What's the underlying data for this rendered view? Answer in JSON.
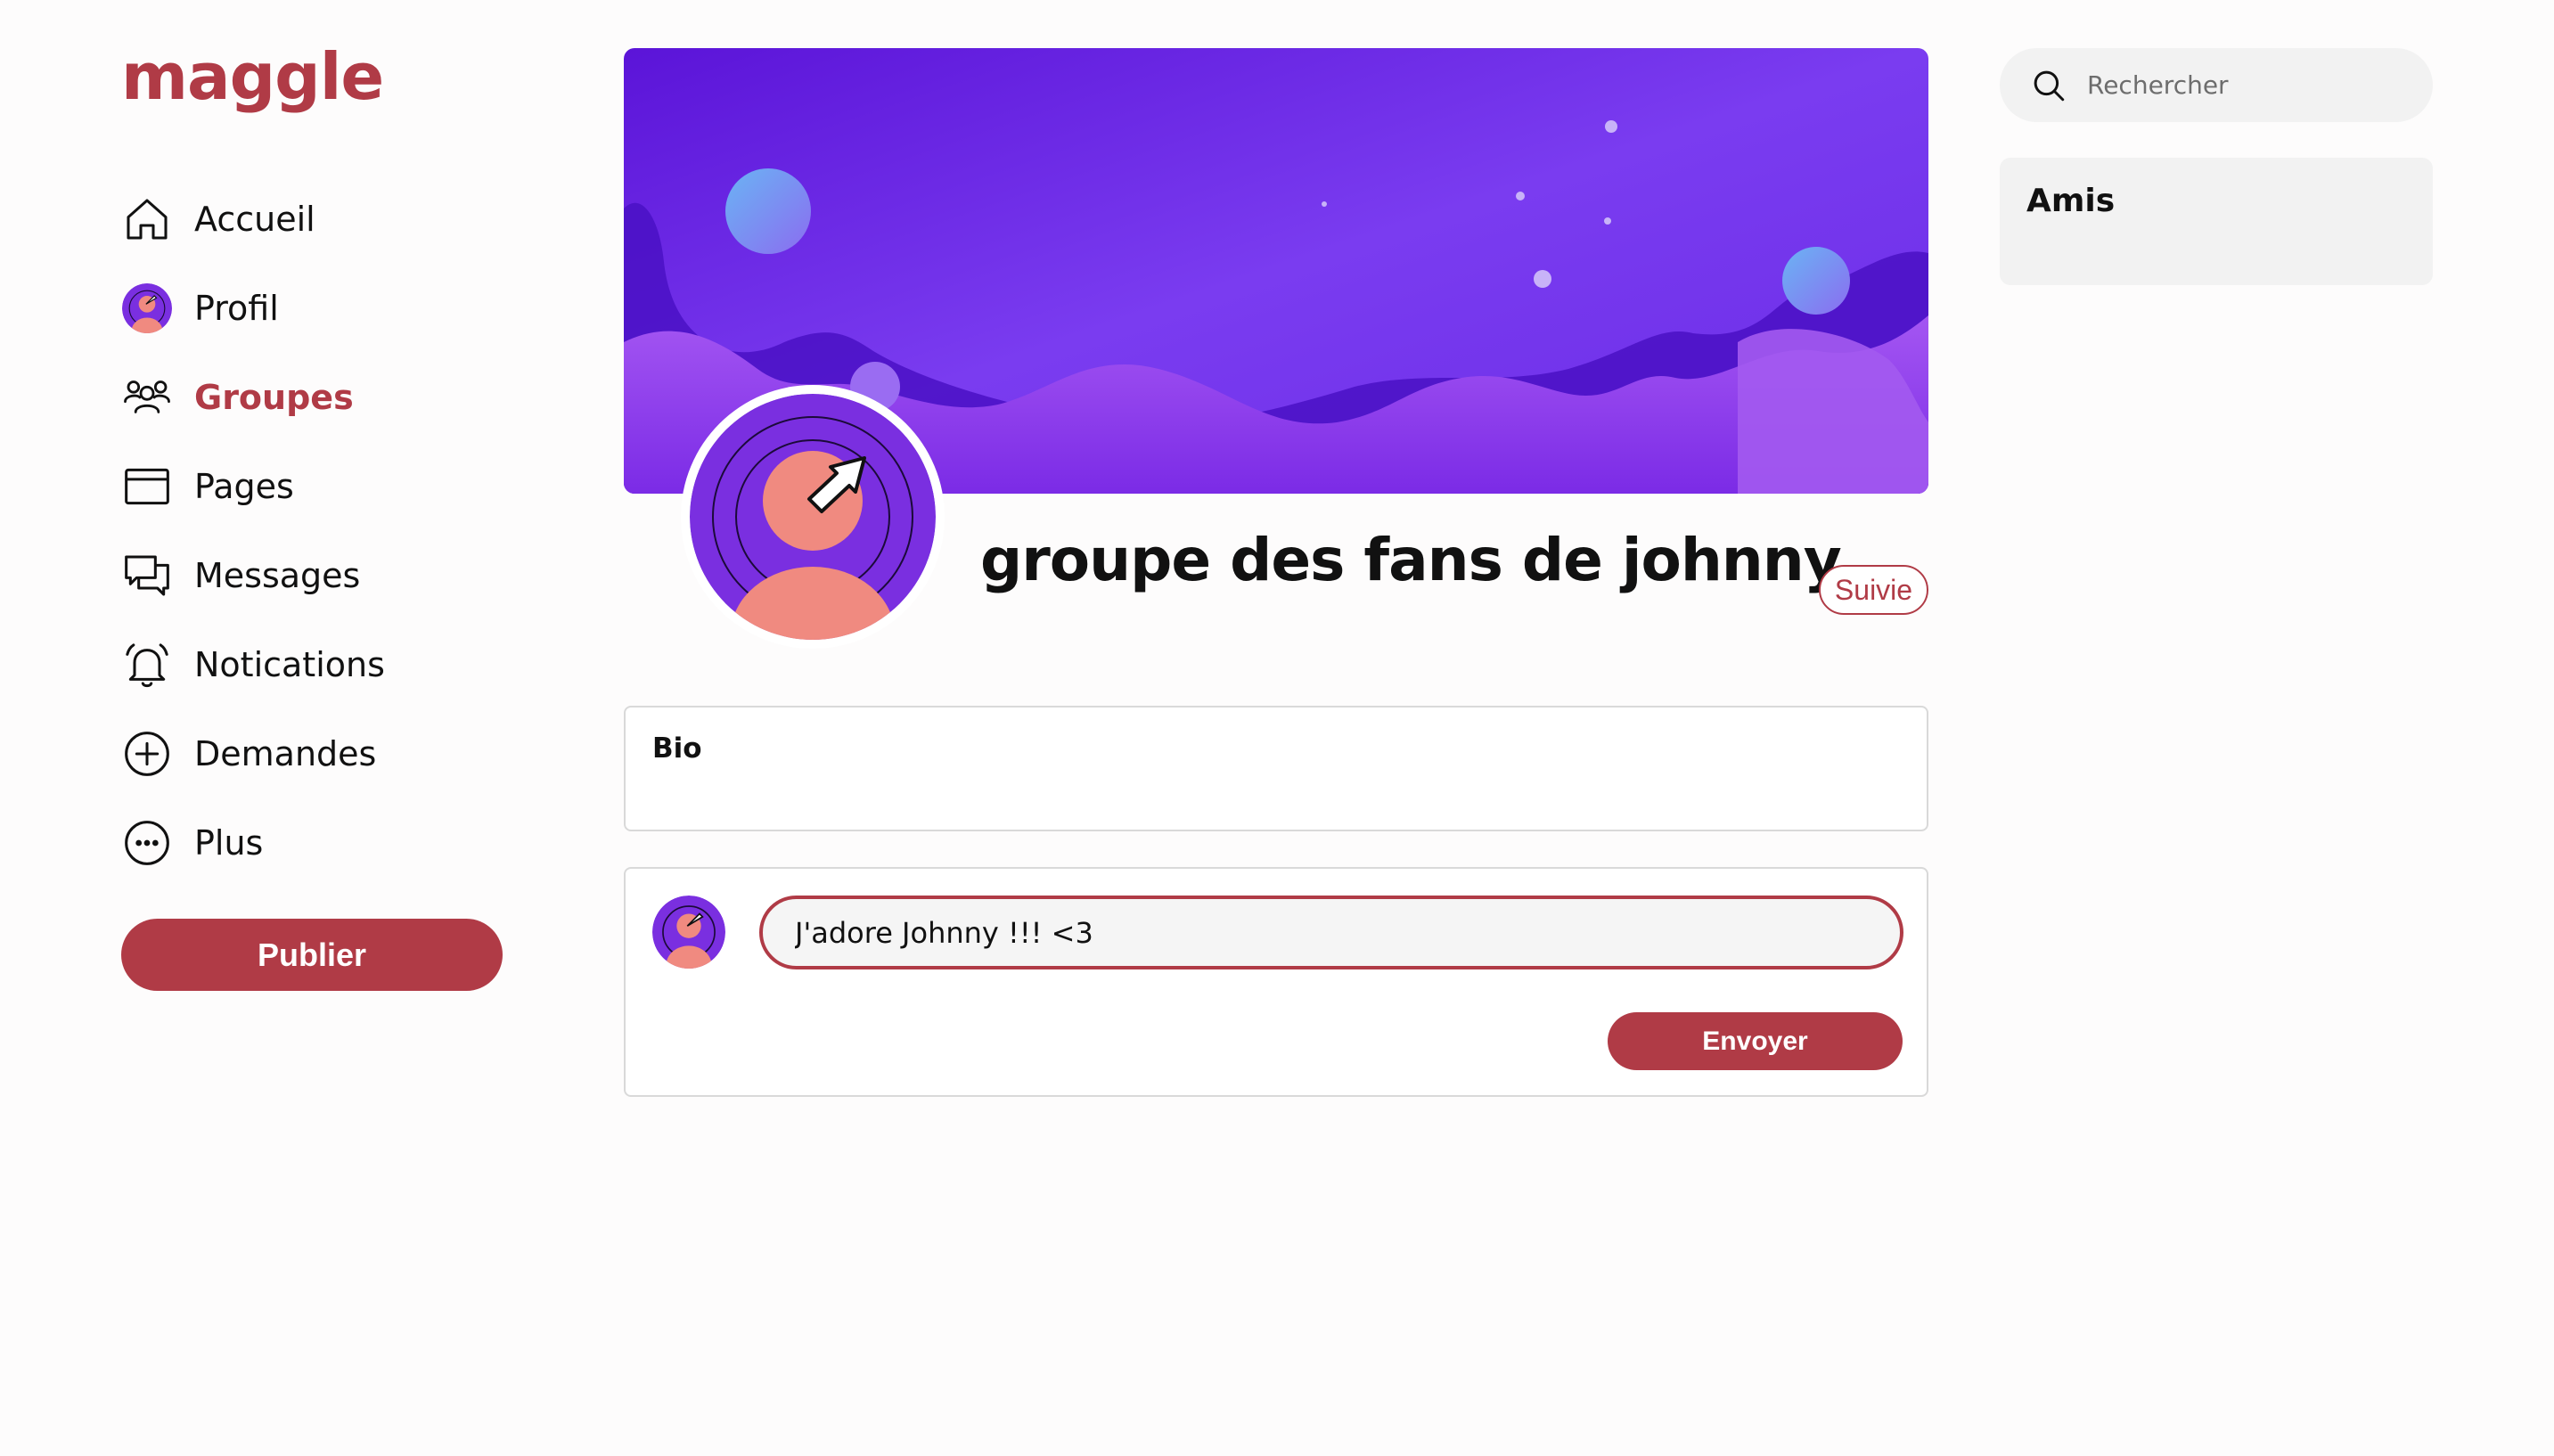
{
  "app": {
    "logo": "maggle",
    "brand_color": "#b03b46"
  },
  "sidebar": {
    "items": [
      {
        "label": "Accueil",
        "icon": "home-icon",
        "active": false
      },
      {
        "label": "Profil",
        "icon": "avatar",
        "active": false
      },
      {
        "label": "Groupes",
        "icon": "users-icon",
        "active": true
      },
      {
        "label": "Pages",
        "icon": "window-icon",
        "active": false
      },
      {
        "label": "Messages",
        "icon": "chat-icon",
        "active": false
      },
      {
        "label": "Notications",
        "icon": "bell-icon",
        "active": false
      },
      {
        "label": "Demandes",
        "icon": "plus-circle-icon",
        "active": false
      },
      {
        "label": "Plus",
        "icon": "more-icon",
        "active": false
      }
    ],
    "publish_label": "Publier"
  },
  "group": {
    "title": "groupe des fans de johnny",
    "follow_label": "Suivie",
    "bio_title": "Bio"
  },
  "composer": {
    "value": "J'adore Johnny !!! <3",
    "send_label": "Envoyer"
  },
  "search": {
    "placeholder": "Rechercher"
  },
  "friends": {
    "title": "Amis"
  }
}
